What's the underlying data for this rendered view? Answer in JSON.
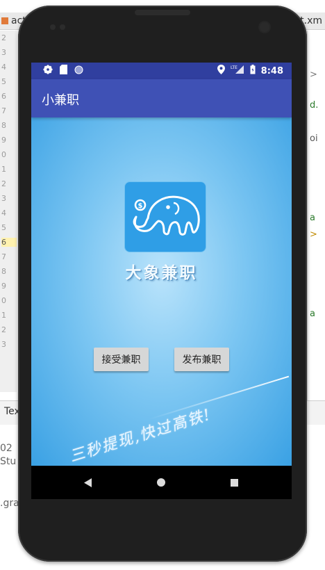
{
  "ide": {
    "tab_left": "acti",
    "tab_right": "t.xm",
    "gutter_lines": [
      "2",
      "3",
      "4",
      "5",
      "6",
      "7",
      "8",
      "9",
      "0",
      "1",
      "2",
      "3",
      "4",
      "5",
      "6",
      "7",
      "8",
      "9",
      "0",
      "1",
      "2",
      "3"
    ],
    "right_fragments": [
      ">",
      "d.",
      "oi",
      "a",
      ">",
      "a"
    ],
    "bottom_tab": "Tex",
    "log_lines": [
      "02",
      "Stu",
      ".gra"
    ]
  },
  "status_bar": {
    "left_icons": [
      "settings-icon",
      "sd-card-icon",
      "circle-icon"
    ],
    "right_icons": [
      "location-icon",
      "lte-signal-icon",
      "battery-icon"
    ],
    "lte_label": "LTE",
    "time": "8:48"
  },
  "app_bar": {
    "title": "小兼职"
  },
  "splash": {
    "brand_name": "大象兼职",
    "slogan": "三秒提现,快过高铁!"
  },
  "buttons": {
    "accept": "接受兼职",
    "publish": "发布兼职"
  },
  "nav_bar": {
    "icons": [
      "back-icon",
      "home-icon",
      "recents-icon"
    ]
  },
  "colors": {
    "status_bar": "#303f9f",
    "app_bar": "#3f51b5",
    "splash_bg": "#3aa1e4",
    "button_bg": "#d6d7d7"
  }
}
